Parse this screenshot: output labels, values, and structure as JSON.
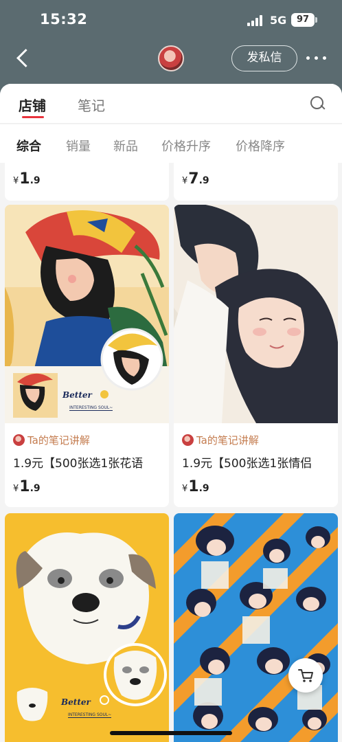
{
  "status_bar": {
    "time": "15:32",
    "network": "5G",
    "battery": "97"
  },
  "header": {
    "dm_label": "发私信"
  },
  "tabs": [
    {
      "label": "店铺",
      "active": true
    },
    {
      "label": "笔记",
      "active": false
    }
  ],
  "filters": [
    {
      "label": "综合",
      "active": true
    },
    {
      "label": "销量",
      "active": false
    },
    {
      "label": "新品",
      "active": false
    },
    {
      "label": "价格升序",
      "active": false
    },
    {
      "label": "价格降序",
      "active": false
    }
  ],
  "products": [
    {
      "price_yen": "¥",
      "price_int": "1",
      "price_dec": ".9"
    },
    {
      "price_yen": "¥",
      "price_int": "7",
      "price_dec": ".9"
    },
    {
      "note_link": "Ta的笔记讲解",
      "title": "1.9元【500张选1张花语",
      "price_yen": "¥",
      "price_int": "1",
      "price_dec": ".9",
      "tag": "Better",
      "tag_sub": "INTERESTING SOUL~"
    },
    {
      "note_link": "Ta的笔记讲解",
      "title": "1.9元【500张选1张情侣",
      "price_yen": "¥",
      "price_int": "1",
      "price_dec": ".9"
    },
    {
      "tag": "Better",
      "tag_sub": "INTERESTING SOUL~"
    },
    {}
  ],
  "icons": [
    "back-icon",
    "more-icon",
    "search-icon",
    "cart-icon",
    "signal-icon"
  ],
  "colors": {
    "accent": "#e8323c",
    "header_bg": "#5b6b70",
    "note_link": "#c47c4f"
  }
}
